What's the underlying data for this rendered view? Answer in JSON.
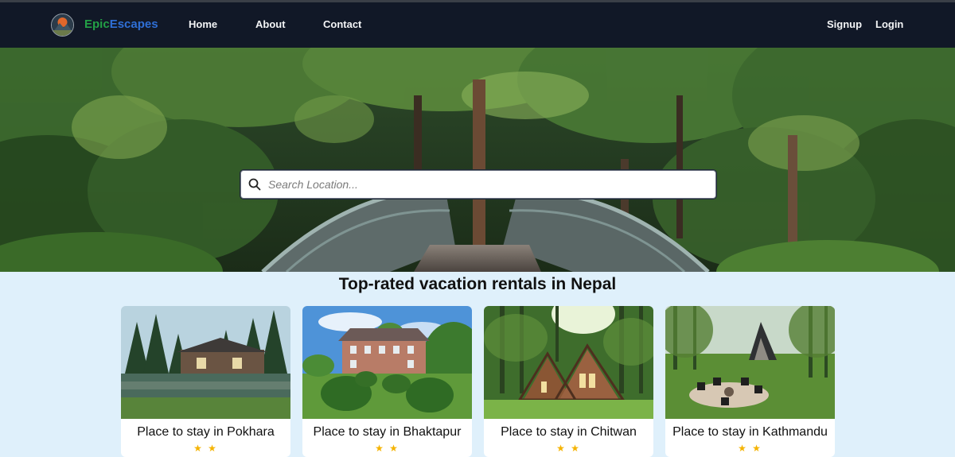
{
  "nav": {
    "brand_part1": "Epic",
    "brand_part2": "Escapes",
    "links": [
      {
        "label": "Home"
      },
      {
        "label": "About"
      },
      {
        "label": "Contact"
      }
    ],
    "signup_label": "Signup",
    "login_label": "Login"
  },
  "hero": {
    "search_placeholder": "Search Location..."
  },
  "section": {
    "title": "Top-rated vacation rentals in Nepal"
  },
  "cards": [
    {
      "title": "Place to stay in Pokhara",
      "rating_stars": "★ ★"
    },
    {
      "title": "Place to stay in Bhaktapur",
      "rating_stars": "★ ★"
    },
    {
      "title": "Place to stay in Chitwan",
      "rating_stars": "★ ★"
    },
    {
      "title": "Place to stay in Kathmandu",
      "rating_stars": "★ ★"
    }
  ],
  "colors": {
    "navbar_bg": "#111827",
    "brand_green": "#23a046",
    "brand_blue": "#2f6fd6",
    "page_bg": "#dff0fb",
    "star": "#f5b301"
  }
}
